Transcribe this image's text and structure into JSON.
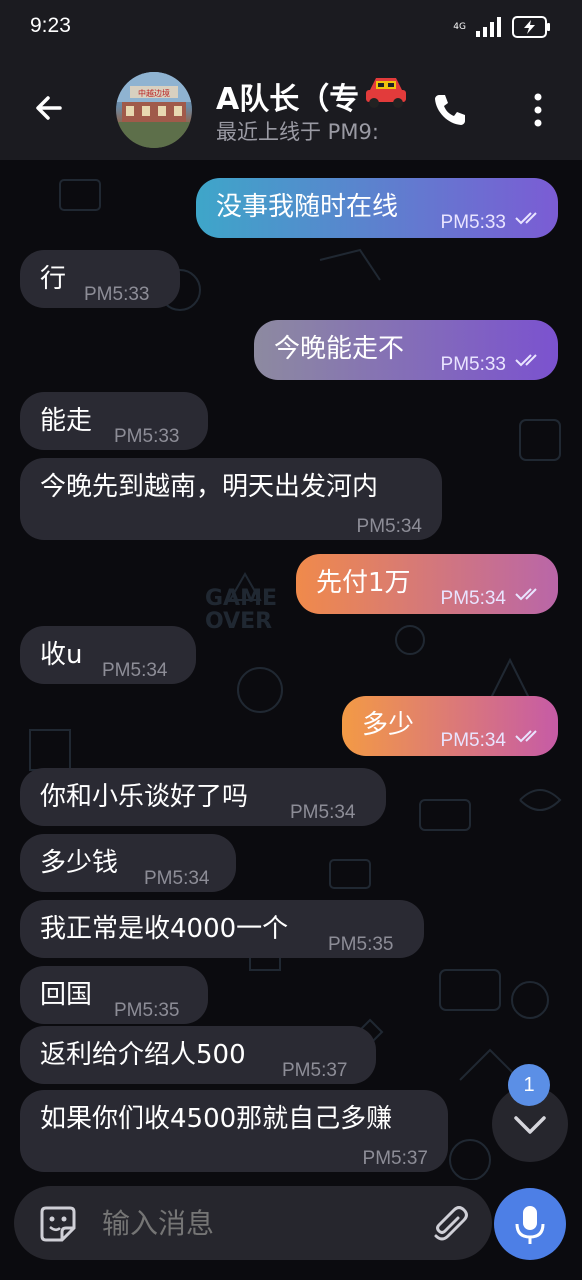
{
  "status_bar": {
    "time": "9:23",
    "network_label": "4G"
  },
  "header": {
    "title": "A队长（专",
    "status": "最近上线于 PM9:",
    "avatar_text": "中越边境"
  },
  "messages": [
    {
      "dir": "out",
      "text": "没事我随时在线",
      "time": "PM5:33",
      "read": true
    },
    {
      "dir": "in",
      "text": "行",
      "time": "PM5:33"
    },
    {
      "dir": "out",
      "text": "今晚能走不",
      "time": "PM5:33",
      "read": true
    },
    {
      "dir": "in",
      "text": "能走",
      "time": "PM5:33"
    },
    {
      "dir": "in",
      "text": "今晚先到越南，明天出发河内",
      "time": "PM5:34"
    },
    {
      "dir": "out",
      "text": "先付1万",
      "time": "PM5:34",
      "read": true
    },
    {
      "dir": "in",
      "text": "收u",
      "time": "PM5:34"
    },
    {
      "dir": "out",
      "text": "多少",
      "time": "PM5:34",
      "read": true
    },
    {
      "dir": "in",
      "text": "你和小乐谈好了吗",
      "time": "PM5:34"
    },
    {
      "dir": "in",
      "text": "多少钱",
      "time": "PM5:34"
    },
    {
      "dir": "in",
      "text": "我正常是收4000一个",
      "time": "PM5:35"
    },
    {
      "dir": "in",
      "text": "回国",
      "time": "PM5:35"
    },
    {
      "dir": "in",
      "text": "返利给介绍人500",
      "time": "PM5:37"
    },
    {
      "dir": "in",
      "text": "如果你们收4500那就自己多赚",
      "time": "PM5:37"
    }
  ],
  "scroll_badge": {
    "count": "1"
  },
  "composer": {
    "placeholder": "输入消息"
  },
  "icons": {
    "back": "arrow-left-icon",
    "call": "phone-icon",
    "more": "more-vertical-icon",
    "sticker": "sticker-icon",
    "attach": "paperclip-icon",
    "mic": "microphone-icon",
    "scroll": "chevron-down-icon"
  },
  "colors": {
    "background": "#0b0b0f",
    "incoming_bubble": "#2a2a33",
    "accent": "#4d7fe6"
  }
}
